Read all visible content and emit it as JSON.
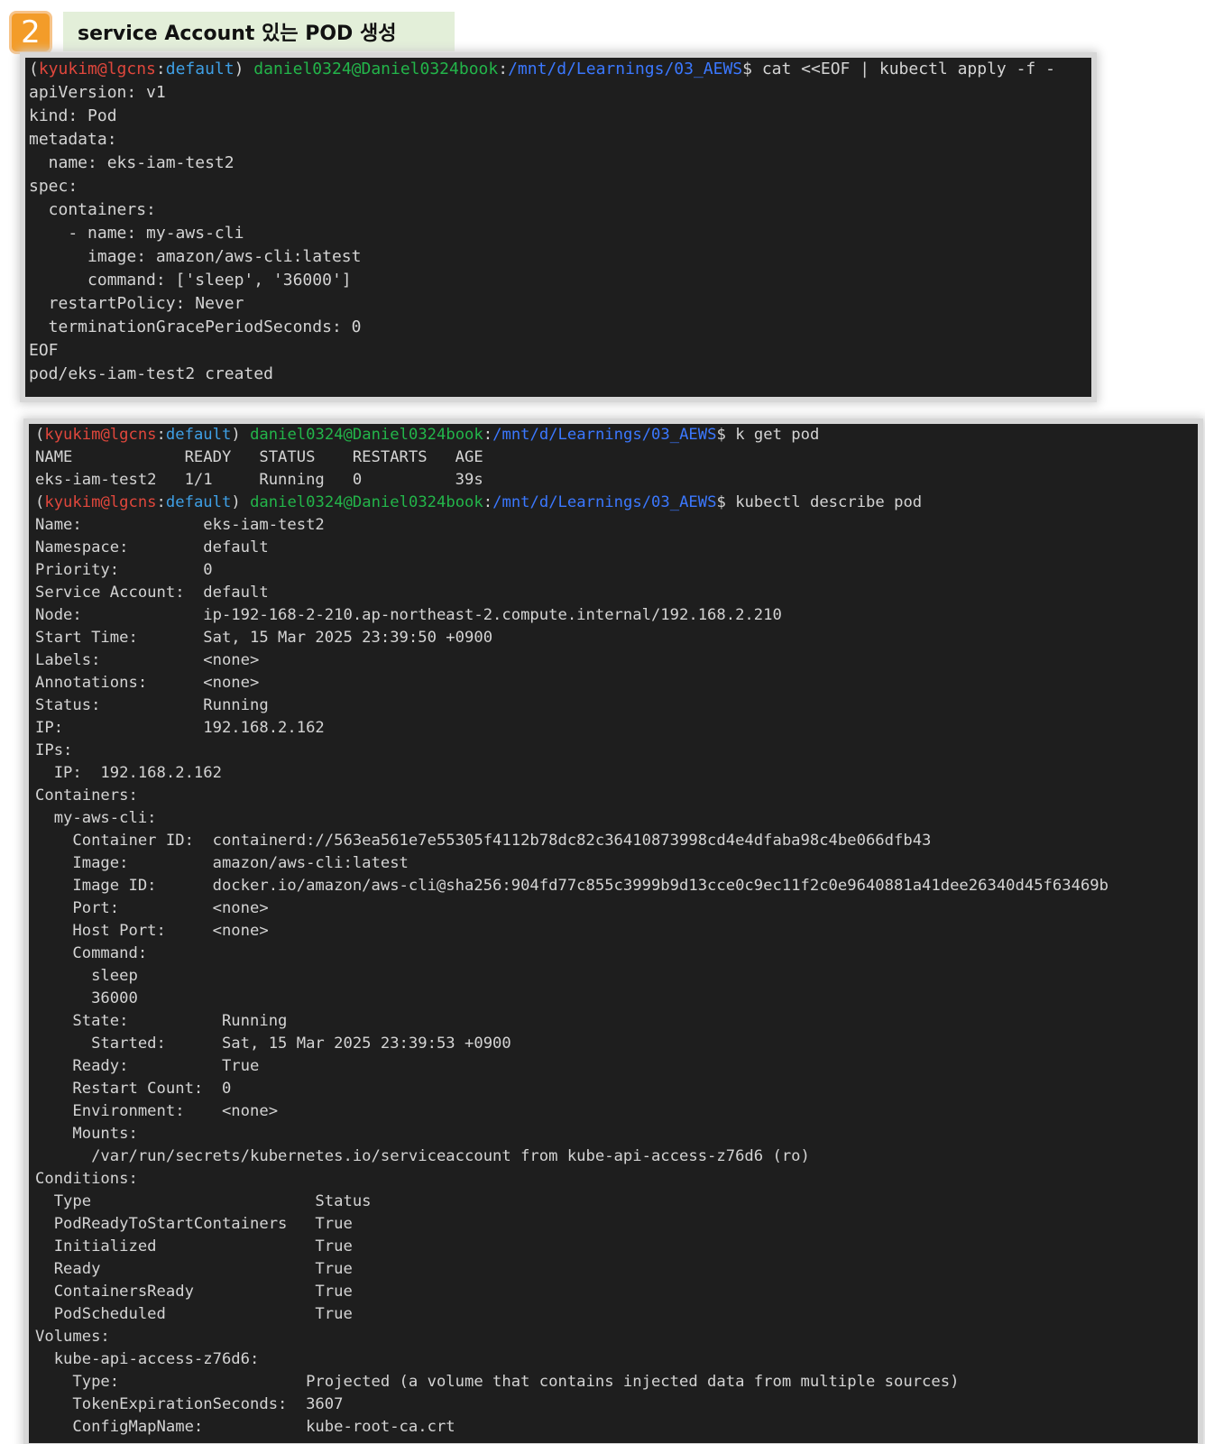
{
  "header": {
    "step_number": "2",
    "title": "service Account 있는 POD 생성"
  },
  "colors": {
    "terminal_bg": "#1e1e1e",
    "terminal_text": "#d4d4d4",
    "prompt_user": "#e0473c",
    "prompt_context": "#3fa0e6",
    "prompt_user_host": "#23b54a",
    "prompt_path": "#3b78ff",
    "badge": "#f39c29",
    "title_bg": "#e3efd9"
  },
  "prompt": {
    "open": "(",
    "user": "kyukim@lgcns",
    "sep": ":",
    "context": "default",
    "close": ")",
    "user_host": "daniel0324@Daniel0324book",
    "path": "/mnt/d/Learnings/03_AEWS",
    "symbol": "$"
  },
  "terminal1": {
    "command": " cat <<EOF | kubectl apply -f -",
    "lines": [
      "apiVersion: v1",
      "kind: Pod",
      "metadata:",
      "  name: eks-iam-test2",
      "spec:",
      "  containers:",
      "    - name: my-aws-cli",
      "      image: amazon/aws-cli:latest",
      "      command: ['sleep', '36000']",
      "  restartPolicy: Never",
      "  terminationGracePeriodSeconds: 0",
      "EOF",
      "pod/eks-iam-test2 created"
    ]
  },
  "terminal2": {
    "command1": " k get pod",
    "get_pod_lines": [
      "NAME            READY   STATUS    RESTARTS   AGE",
      "eks-iam-test2   1/1     Running   0          39s"
    ],
    "command2": " kubectl describe pod",
    "describe_lines": [
      "Name:             eks-iam-test2",
      "Namespace:        default",
      "Priority:         0",
      "Service Account:  default",
      "Node:             ip-192-168-2-210.ap-northeast-2.compute.internal/192.168.2.210",
      "Start Time:       Sat, 15 Mar 2025 23:39:50 +0900",
      "Labels:           <none>",
      "Annotations:      <none>",
      "Status:           Running",
      "IP:               192.168.2.162",
      "IPs:",
      "  IP:  192.168.2.162",
      "Containers:",
      "  my-aws-cli:",
      "    Container ID:  containerd://563ea561e7e55305f4112b78dc82c36410873998cd4e4dfaba98c4be066dfb43",
      "    Image:         amazon/aws-cli:latest",
      "    Image ID:      docker.io/amazon/aws-cli@sha256:904fd77c855c3999b9d13cce0c9ec11f2c0e9640881a41dee26340d45f63469b",
      "    Port:          <none>",
      "    Host Port:     <none>",
      "    Command:",
      "      sleep",
      "      36000",
      "    State:          Running",
      "      Started:      Sat, 15 Mar 2025 23:39:53 +0900",
      "    Ready:          True",
      "    Restart Count:  0",
      "    Environment:    <none>",
      "    Mounts:",
      "      /var/run/secrets/kubernetes.io/serviceaccount from kube-api-access-z76d6 (ro)",
      "Conditions:",
      "  Type                        Status",
      "  PodReadyToStartContainers   True",
      "  Initialized                 True",
      "  Ready                       True",
      "  ContainersReady             True",
      "  PodScheduled                True",
      "Volumes:",
      "  kube-api-access-z76d6:",
      "    Type:                    Projected (a volume that contains injected data from multiple sources)",
      "    TokenExpirationSeconds:  3607",
      "    ConfigMapName:           kube-root-ca.crt"
    ]
  }
}
